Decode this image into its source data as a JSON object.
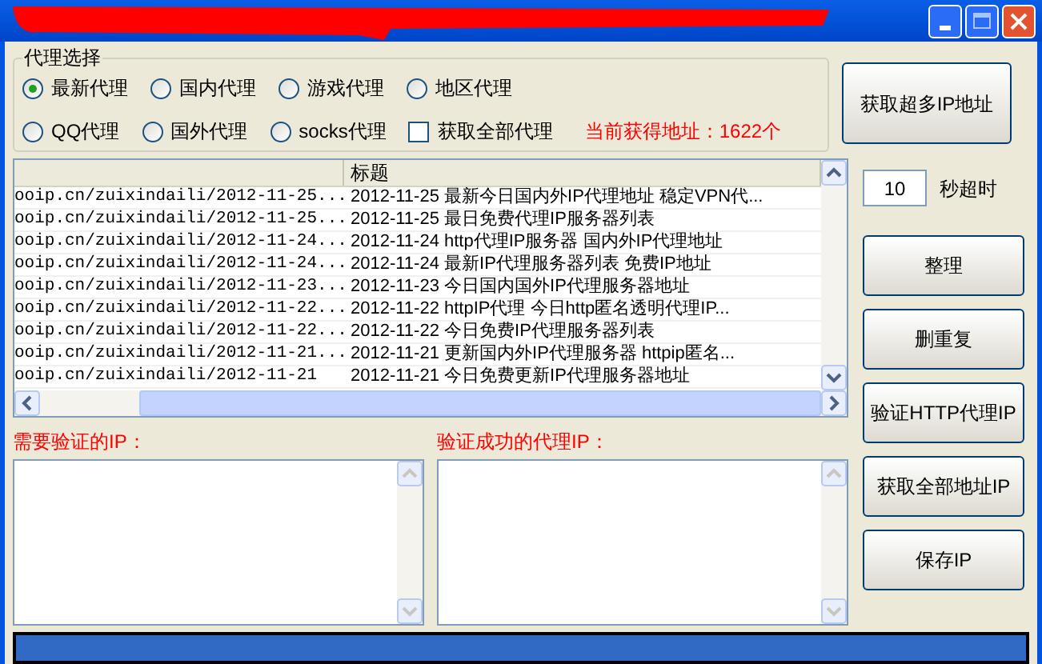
{
  "proxy_group": {
    "title": "代理选择",
    "options": [
      {
        "kind": "radio",
        "label": "最新代理",
        "selected": true
      },
      {
        "kind": "radio",
        "label": "国内代理",
        "selected": false
      },
      {
        "kind": "radio",
        "label": "游戏代理",
        "selected": false
      },
      {
        "kind": "radio",
        "label": "地区代理",
        "selected": false
      },
      {
        "kind": "radio",
        "label": "QQ代理",
        "selected": false
      },
      {
        "kind": "radio",
        "label": "国外代理",
        "selected": false
      },
      {
        "kind": "radio",
        "label": "socks代理",
        "selected": false
      },
      {
        "kind": "checkbox",
        "label": "获取全部代理",
        "checked": false
      }
    ],
    "status": "当前获得地址：1622个"
  },
  "fetch_button": "获取超多IP地址",
  "table": {
    "columns": [
      "",
      "标题"
    ],
    "rows": [
      [
        "ooip.cn/zuixindaili/2012-11-25...",
        "2012-11-25 最新今日国内外IP代理地址 稳定VPN代..."
      ],
      [
        "ooip.cn/zuixindaili/2012-11-25...",
        "2012-11-25 最日免费代理IP服务器列表"
      ],
      [
        "ooip.cn/zuixindaili/2012-11-24...",
        "2012-11-24 http代理IP服务器 国内外IP代理地址"
      ],
      [
        "ooip.cn/zuixindaili/2012-11-24...",
        "2012-11-24 最新IP代理服务器列表 免费IP地址"
      ],
      [
        "ooip.cn/zuixindaili/2012-11-23...",
        "2012-11-23 今日国内国外IP代理服务器地址"
      ],
      [
        "ooip.cn/zuixindaili/2012-11-22...",
        "2012-11-22 httpIP代理 今日http匿名透明代理IP..."
      ],
      [
        "ooip.cn/zuixindaili/2012-11-22...",
        "2012-11-22 今日免费IP代理服务器列表"
      ],
      [
        "ooip.cn/zuixindaili/2012-11-21...",
        "2012-11-21 更新国内外IP代理服务器 httpip匿名..."
      ],
      [
        "ooip.cn/zuixindaili/2012-11-21",
        "2012-11-21 今日免费更新IP代理服务器地址"
      ]
    ]
  },
  "timeout": {
    "value": "10",
    "label": "秒超时"
  },
  "side_buttons": [
    "整理",
    "删重复",
    "验证HTTP代理IP",
    "获取全部地址IP",
    "保存IP"
  ],
  "to_verify": {
    "label": "需要验证的IP："
  },
  "verified": {
    "label": "验证成功的代理IP："
  },
  "progress": {
    "level": 1
  }
}
